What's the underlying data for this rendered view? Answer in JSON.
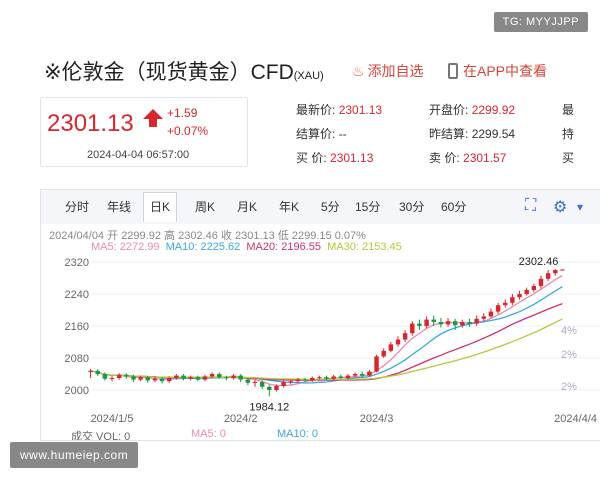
{
  "watermark_top": "TG: MYYJJPP",
  "watermark_bottom": "www.humeiep.com",
  "header": {
    "title": "※伦敦金（现货黄金）CFD",
    "title_sub": "(XAU)",
    "fav_label": "添加自选",
    "app_label": "在APP中查看"
  },
  "price": {
    "last": "2301.13",
    "change": "+1.59",
    "change_pct": "+0.07%",
    "datetime": "2024-04-04 06:57:00"
  },
  "quote": {
    "latest_label": "最新价:",
    "latest": "2301.13",
    "settle_label": "结算价:",
    "settle": "--",
    "bid_label": "买  价:",
    "bid": "2301.13",
    "open_label": "开盘价:",
    "open": "2299.92",
    "prev_label": "昨结算:",
    "prev": "2299.54",
    "ask_label": "卖  价:",
    "ask": "2301.57",
    "col3_1": "最",
    "col3_2": "持",
    "col3_3": "买"
  },
  "tabs": [
    "分时",
    "年线",
    "日K",
    "周K",
    "月K",
    "年K",
    "5分",
    "15分",
    "30分",
    "60分"
  ],
  "active_tab": "日K",
  "toolbar_icons": [
    "fullscreen-icon",
    "settings-icon",
    "collapse-icon"
  ],
  "info_line": {
    "date": "2024/04/04",
    "open_label": "开",
    "open": "2299.92",
    "high_label": "高",
    "high": "2302.46",
    "close_label": "收",
    "close": "2301.13",
    "low_label": "低",
    "low": "2299.15",
    "pct": "0.07%"
  },
  "ma_line": {
    "ma5": "MA5: 2272.99",
    "ma10": "MA10: 2225.62",
    "ma20": "MA20: 2196.55",
    "ma30": "MA30: 2153.45"
  },
  "chart_labels": {
    "high_marker": "2302.46",
    "low_marker": "1984.12",
    "right_pct": [
      "4%",
      "2%",
      "2%"
    ]
  },
  "volume": {
    "label": "成交 VOL: 0",
    "ma5": "MA5: 0",
    "ma10": "MA10: 0"
  },
  "colors": {
    "up": "#d8262f",
    "down": "#1a9a3d",
    "ma5": "#e98ab0",
    "ma10": "#3aa7de",
    "ma20": "#d0306e",
    "ma30": "#b6c73a"
  },
  "chart_data": {
    "type": "candlestick",
    "y_ticks": [
      2000,
      2080,
      2160,
      2240,
      2320
    ],
    "ylim": [
      1970,
      2330
    ],
    "x_ticks": [
      "2024/1/5",
      "2024/2",
      "2024/3",
      "2024/4/4"
    ],
    "x_tick_positions": [
      0,
      21,
      40,
      60
    ],
    "candles": [
      [
        2045,
        2048,
        2030,
        2052
      ],
      [
        2048,
        2040,
        2035,
        2052
      ],
      [
        2040,
        2028,
        2024,
        2044
      ],
      [
        2028,
        2030,
        2022,
        2036
      ],
      [
        2030,
        2038,
        2026,
        2042
      ],
      [
        2038,
        2034,
        2028,
        2042
      ],
      [
        2034,
        2026,
        2020,
        2038
      ],
      [
        2026,
        2032,
        2022,
        2036
      ],
      [
        2032,
        2024,
        2018,
        2036
      ],
      [
        2024,
        2028,
        2020,
        2034
      ],
      [
        2028,
        2022,
        2016,
        2032
      ],
      [
        2022,
        2030,
        2018,
        2034
      ],
      [
        2030,
        2036,
        2026,
        2040
      ],
      [
        2036,
        2028,
        2024,
        2040
      ],
      [
        2028,
        2032,
        2024,
        2036
      ],
      [
        2032,
        2026,
        2022,
        2036
      ],
      [
        2026,
        2034,
        2022,
        2038
      ],
      [
        2034,
        2040,
        2030,
        2044
      ],
      [
        2040,
        2032,
        2028,
        2044
      ],
      [
        2032,
        2030,
        2024,
        2036
      ],
      [
        2030,
        2036,
        2026,
        2040
      ],
      [
        2036,
        2026,
        2020,
        2040
      ],
      [
        2026,
        2018,
        2012,
        2030
      ],
      [
        2018,
        2020,
        2008,
        2026
      ],
      [
        2020,
        2008,
        2002,
        2024
      ],
      [
        2008,
        2000,
        1984,
        2012
      ],
      [
        2000,
        2010,
        1996,
        2014
      ],
      [
        2010,
        2020,
        2006,
        2024
      ],
      [
        2020,
        2022,
        2014,
        2026
      ],
      [
        2022,
        2026,
        2018,
        2030
      ],
      [
        2026,
        2024,
        2020,
        2030
      ],
      [
        2024,
        2030,
        2020,
        2034
      ],
      [
        2030,
        2032,
        2026,
        2036
      ],
      [
        2032,
        2028,
        2024,
        2036
      ],
      [
        2028,
        2034,
        2024,
        2038
      ],
      [
        2034,
        2030,
        2026,
        2038
      ],
      [
        2030,
        2036,
        2026,
        2040
      ],
      [
        2036,
        2040,
        2032,
        2044
      ],
      [
        2040,
        2036,
        2030,
        2046
      ],
      [
        2036,
        2046,
        2034,
        2050
      ],
      [
        2046,
        2084,
        2044,
        2088
      ],
      [
        2084,
        2098,
        2080,
        2104
      ],
      [
        2098,
        2114,
        2094,
        2120
      ],
      [
        2114,
        2126,
        2108,
        2134
      ],
      [
        2126,
        2142,
        2120,
        2150
      ],
      [
        2142,
        2166,
        2136,
        2172
      ],
      [
        2166,
        2160,
        2150,
        2176
      ],
      [
        2160,
        2176,
        2154,
        2184
      ],
      [
        2176,
        2170,
        2160,
        2186
      ],
      [
        2170,
        2164,
        2156,
        2180
      ],
      [
        2164,
        2172,
        2158,
        2180
      ],
      [
        2172,
        2162,
        2150,
        2178
      ],
      [
        2162,
        2170,
        2156,
        2176
      ],
      [
        2170,
        2166,
        2158,
        2178
      ],
      [
        2166,
        2178,
        2160,
        2186
      ],
      [
        2178,
        2184,
        2172,
        2192
      ],
      [
        2184,
        2196,
        2180,
        2204
      ],
      [
        2196,
        2212,
        2190,
        2218
      ],
      [
        2212,
        2218,
        2206,
        2226
      ],
      [
        2218,
        2232,
        2212,
        2240
      ],
      [
        2232,
        2240,
        2226,
        2248
      ],
      [
        2240,
        2250,
        2236,
        2256
      ],
      [
        2250,
        2260,
        2244,
        2266
      ],
      [
        2260,
        2278,
        2254,
        2286
      ],
      [
        2278,
        2292,
        2272,
        2300
      ],
      [
        2292,
        2300,
        2286,
        2302
      ],
      [
        2299.92,
        2301.13,
        2299.15,
        2302.46
      ]
    ]
  }
}
